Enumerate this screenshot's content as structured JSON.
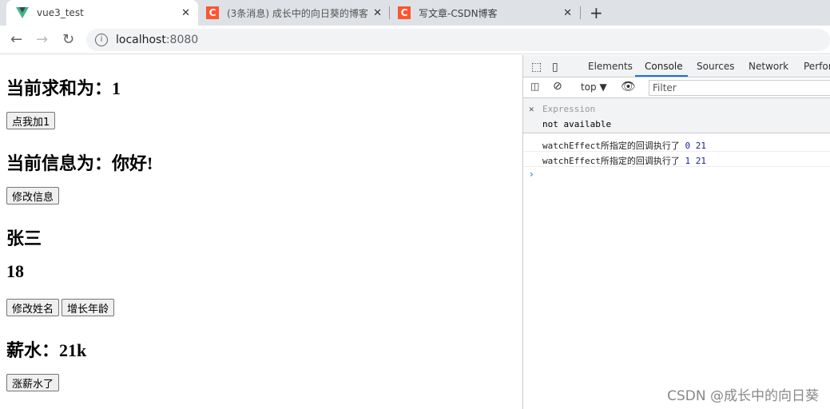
{
  "browser": {
    "tabs": [
      {
        "title": "vue3_test",
        "icon": "vue-logo-icon"
      },
      {
        "title": "(3条消息) 成长中的向日葵的博客",
        "icon": "csdn-icon"
      },
      {
        "title": "写文章-CSDN博客",
        "icon": "csdn-icon"
      }
    ],
    "url_host": "localhost",
    "url_port": ":8080"
  },
  "page": {
    "sum": "当前求和为：1",
    "add_btn": "点我加1",
    "msg": "当前信息为：你好!",
    "msg_btn": "修改信息",
    "name": "张三",
    "age": "18",
    "name_btn": "修改姓名",
    "age_btn": "增长年龄",
    "salary": "薪水：21k",
    "salary_btn": "涨薪水了"
  },
  "devtools": {
    "tabs": [
      "Elements",
      "Console",
      "Sources",
      "Network",
      "Perfor"
    ],
    "context": "top ▼",
    "filter_placeholder": "Filter",
    "expression_label": "Expression",
    "expression_value": "not available",
    "logs": [
      {
        "text": "watchEffect所指定的回调执行了",
        "a": "0",
        "b": "21"
      },
      {
        "text": "watchEffect所指定的回调执行了",
        "a": "1",
        "b": "21"
      }
    ],
    "accent": "#1a73e8"
  },
  "watermark": "CSDN @成长中的向日葵"
}
